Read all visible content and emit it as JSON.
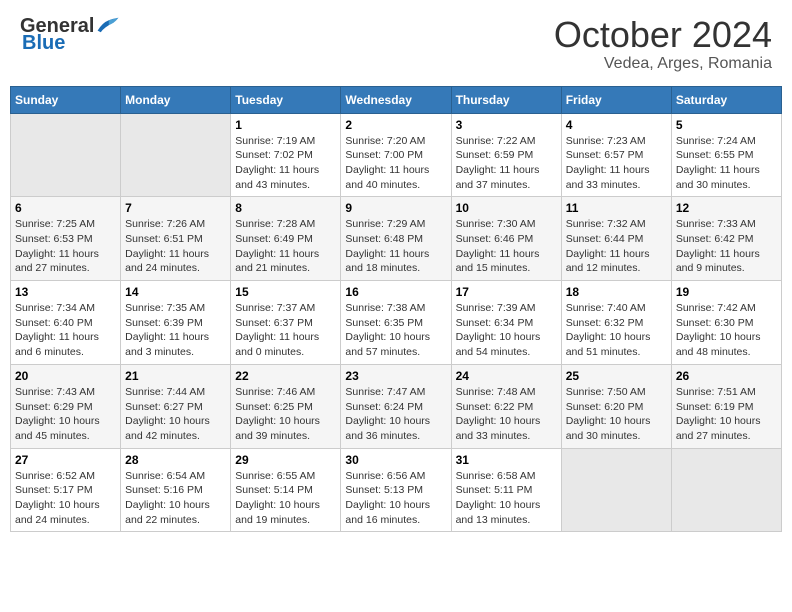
{
  "header": {
    "logo_general": "General",
    "logo_blue": "Blue",
    "month_title": "October 2024",
    "location": "Vedea, Arges, Romania"
  },
  "days_of_week": [
    "Sunday",
    "Monday",
    "Tuesday",
    "Wednesday",
    "Thursday",
    "Friday",
    "Saturday"
  ],
  "weeks": [
    [
      {
        "day": "",
        "info": ""
      },
      {
        "day": "",
        "info": ""
      },
      {
        "day": "1",
        "sunrise": "Sunrise: 7:19 AM",
        "sunset": "Sunset: 7:02 PM",
        "daylight": "Daylight: 11 hours and 43 minutes."
      },
      {
        "day": "2",
        "sunrise": "Sunrise: 7:20 AM",
        "sunset": "Sunset: 7:00 PM",
        "daylight": "Daylight: 11 hours and 40 minutes."
      },
      {
        "day": "3",
        "sunrise": "Sunrise: 7:22 AM",
        "sunset": "Sunset: 6:59 PM",
        "daylight": "Daylight: 11 hours and 37 minutes."
      },
      {
        "day": "4",
        "sunrise": "Sunrise: 7:23 AM",
        "sunset": "Sunset: 6:57 PM",
        "daylight": "Daylight: 11 hours and 33 minutes."
      },
      {
        "day": "5",
        "sunrise": "Sunrise: 7:24 AM",
        "sunset": "Sunset: 6:55 PM",
        "daylight": "Daylight: 11 hours and 30 minutes."
      }
    ],
    [
      {
        "day": "6",
        "sunrise": "Sunrise: 7:25 AM",
        "sunset": "Sunset: 6:53 PM",
        "daylight": "Daylight: 11 hours and 27 minutes."
      },
      {
        "day": "7",
        "sunrise": "Sunrise: 7:26 AM",
        "sunset": "Sunset: 6:51 PM",
        "daylight": "Daylight: 11 hours and 24 minutes."
      },
      {
        "day": "8",
        "sunrise": "Sunrise: 7:28 AM",
        "sunset": "Sunset: 6:49 PM",
        "daylight": "Daylight: 11 hours and 21 minutes."
      },
      {
        "day": "9",
        "sunrise": "Sunrise: 7:29 AM",
        "sunset": "Sunset: 6:48 PM",
        "daylight": "Daylight: 11 hours and 18 minutes."
      },
      {
        "day": "10",
        "sunrise": "Sunrise: 7:30 AM",
        "sunset": "Sunset: 6:46 PM",
        "daylight": "Daylight: 11 hours and 15 minutes."
      },
      {
        "day": "11",
        "sunrise": "Sunrise: 7:32 AM",
        "sunset": "Sunset: 6:44 PM",
        "daylight": "Daylight: 11 hours and 12 minutes."
      },
      {
        "day": "12",
        "sunrise": "Sunrise: 7:33 AM",
        "sunset": "Sunset: 6:42 PM",
        "daylight": "Daylight: 11 hours and 9 minutes."
      }
    ],
    [
      {
        "day": "13",
        "sunrise": "Sunrise: 7:34 AM",
        "sunset": "Sunset: 6:40 PM",
        "daylight": "Daylight: 11 hours and 6 minutes."
      },
      {
        "day": "14",
        "sunrise": "Sunrise: 7:35 AM",
        "sunset": "Sunset: 6:39 PM",
        "daylight": "Daylight: 11 hours and 3 minutes."
      },
      {
        "day": "15",
        "sunrise": "Sunrise: 7:37 AM",
        "sunset": "Sunset: 6:37 PM",
        "daylight": "Daylight: 11 hours and 0 minutes."
      },
      {
        "day": "16",
        "sunrise": "Sunrise: 7:38 AM",
        "sunset": "Sunset: 6:35 PM",
        "daylight": "Daylight: 10 hours and 57 minutes."
      },
      {
        "day": "17",
        "sunrise": "Sunrise: 7:39 AM",
        "sunset": "Sunset: 6:34 PM",
        "daylight": "Daylight: 10 hours and 54 minutes."
      },
      {
        "day": "18",
        "sunrise": "Sunrise: 7:40 AM",
        "sunset": "Sunset: 6:32 PM",
        "daylight": "Daylight: 10 hours and 51 minutes."
      },
      {
        "day": "19",
        "sunrise": "Sunrise: 7:42 AM",
        "sunset": "Sunset: 6:30 PM",
        "daylight": "Daylight: 10 hours and 48 minutes."
      }
    ],
    [
      {
        "day": "20",
        "sunrise": "Sunrise: 7:43 AM",
        "sunset": "Sunset: 6:29 PM",
        "daylight": "Daylight: 10 hours and 45 minutes."
      },
      {
        "day": "21",
        "sunrise": "Sunrise: 7:44 AM",
        "sunset": "Sunset: 6:27 PM",
        "daylight": "Daylight: 10 hours and 42 minutes."
      },
      {
        "day": "22",
        "sunrise": "Sunrise: 7:46 AM",
        "sunset": "Sunset: 6:25 PM",
        "daylight": "Daylight: 10 hours and 39 minutes."
      },
      {
        "day": "23",
        "sunrise": "Sunrise: 7:47 AM",
        "sunset": "Sunset: 6:24 PM",
        "daylight": "Daylight: 10 hours and 36 minutes."
      },
      {
        "day": "24",
        "sunrise": "Sunrise: 7:48 AM",
        "sunset": "Sunset: 6:22 PM",
        "daylight": "Daylight: 10 hours and 33 minutes."
      },
      {
        "day": "25",
        "sunrise": "Sunrise: 7:50 AM",
        "sunset": "Sunset: 6:20 PM",
        "daylight": "Daylight: 10 hours and 30 minutes."
      },
      {
        "day": "26",
        "sunrise": "Sunrise: 7:51 AM",
        "sunset": "Sunset: 6:19 PM",
        "daylight": "Daylight: 10 hours and 27 minutes."
      }
    ],
    [
      {
        "day": "27",
        "sunrise": "Sunrise: 6:52 AM",
        "sunset": "Sunset: 5:17 PM",
        "daylight": "Daylight: 10 hours and 24 minutes."
      },
      {
        "day": "28",
        "sunrise": "Sunrise: 6:54 AM",
        "sunset": "Sunset: 5:16 PM",
        "daylight": "Daylight: 10 hours and 22 minutes."
      },
      {
        "day": "29",
        "sunrise": "Sunrise: 6:55 AM",
        "sunset": "Sunset: 5:14 PM",
        "daylight": "Daylight: 10 hours and 19 minutes."
      },
      {
        "day": "30",
        "sunrise": "Sunrise: 6:56 AM",
        "sunset": "Sunset: 5:13 PM",
        "daylight": "Daylight: 10 hours and 16 minutes."
      },
      {
        "day": "31",
        "sunrise": "Sunrise: 6:58 AM",
        "sunset": "Sunset: 5:11 PM",
        "daylight": "Daylight: 10 hours and 13 minutes."
      },
      {
        "day": "",
        "info": ""
      },
      {
        "day": "",
        "info": ""
      }
    ]
  ]
}
